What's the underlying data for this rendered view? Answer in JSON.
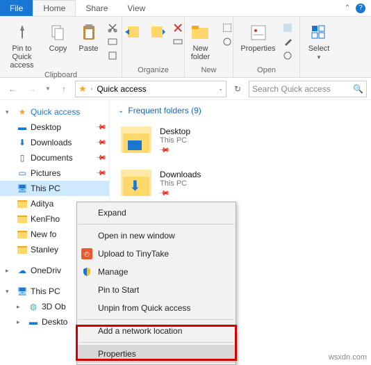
{
  "tabs": {
    "file": "File",
    "home": "Home",
    "share": "Share",
    "view": "View"
  },
  "ribbon": {
    "pin": "Pin to Quick\naccess",
    "copy": "Copy",
    "paste": "Paste",
    "clipboard": "Clipboard",
    "organize": "Organize",
    "newfolder": "New\nfolder",
    "new": "New",
    "properties": "Properties",
    "open": "Open",
    "select": "Select"
  },
  "addr": {
    "location": "Quick access",
    "search_ph": "Search Quick access"
  },
  "sidebar": {
    "quick": "Quick access",
    "items": [
      {
        "label": "Desktop"
      },
      {
        "label": "Downloads"
      },
      {
        "label": "Documents"
      },
      {
        "label": "Pictures"
      },
      {
        "label": "This PC"
      },
      {
        "label": "Aditya"
      },
      {
        "label": "KenFho"
      },
      {
        "label": "New fo"
      },
      {
        "label": "Stanley"
      }
    ],
    "onedrive": "OneDriv",
    "thispc": "This PC",
    "thispc_children": [
      {
        "label": "3D Ob"
      },
      {
        "label": "Deskto"
      }
    ]
  },
  "content": {
    "header": "Frequent folders (9)",
    "items": [
      {
        "name": "Desktop",
        "loc": "This PC",
        "arrow": false
      },
      {
        "name": "Downloads",
        "loc": "This PC",
        "arrow": true
      }
    ]
  },
  "ctx": {
    "expand": "Expand",
    "open_new": "Open in new window",
    "tinytake": "Upload to TinyTake",
    "manage": "Manage",
    "pin_start": "Pin to Start",
    "unpin_qa": "Unpin from Quick access",
    "add_net": "Add a network location",
    "properties": "Properties"
  },
  "footer": "wsxdn.com"
}
